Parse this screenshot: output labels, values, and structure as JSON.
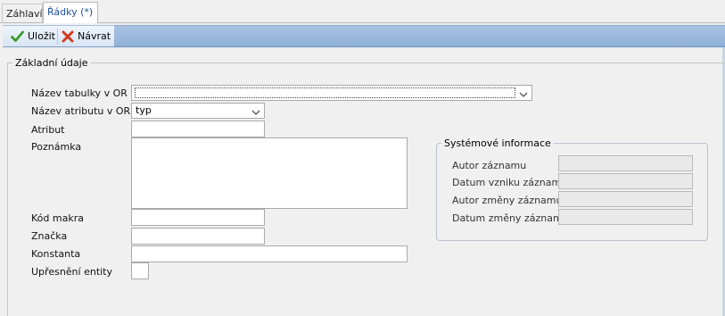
{
  "tabs": [
    {
      "label": "Záhlaví"
    },
    {
      "label": "Řádky  (*)"
    }
  ],
  "toolbar": {
    "save_label": "Uložit",
    "back_label": "Návrat"
  },
  "group": {
    "title": "Základní údaje"
  },
  "form": {
    "table_label": "Název tabulky v OR",
    "table_value": "",
    "attr_name_label": "Název atributu v OR",
    "attr_name_value": "typ",
    "attribute_label": "Atribut",
    "note_label": "Poznámka",
    "macro_label": "Kód makra",
    "tag_label": "Značka",
    "const_label": "Konstanta",
    "entity_label": "Upřesnění entity"
  },
  "system": {
    "title": "Systémové informace",
    "author_label": "Autor záznamu",
    "created_label": "Datum vzniku záznamu",
    "modifier_label": "Autor změny záznamu",
    "modified_label": "Datum změny záznamu"
  },
  "colors": {
    "active_tab_text": "#1d4f9c",
    "toolbar_accent": "#8fb0d8",
    "save_icon": "#3a9a2a",
    "back_icon": "#d23a1e"
  },
  "icons": {
    "save": "check-icon",
    "back": "cross-icon",
    "dropdown": "chevron-down-icon"
  }
}
